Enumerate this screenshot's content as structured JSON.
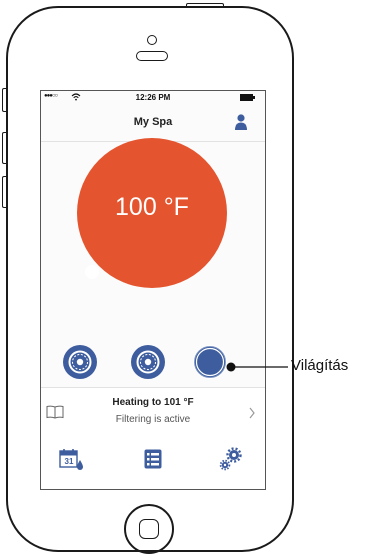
{
  "status_bar": {
    "time": "12:26 PM",
    "signal_dots": "●●●○○"
  },
  "header": {
    "title": "My Spa",
    "profile_icon": "person-icon"
  },
  "temperature": {
    "display": "100 °F",
    "color": "#e4542e"
  },
  "controls": {
    "jet1_icon": "jet-icon",
    "jet2_icon": "jet-icon",
    "light_icon": "light-icon",
    "color": "#3d5d9e"
  },
  "status_panel": {
    "heating_text": "Heating to 101 °F",
    "filter_text": "Filtering is active"
  },
  "tabs": [
    {
      "icon": "calendar-icon",
      "date": "31"
    },
    {
      "icon": "list-icon"
    },
    {
      "icon": "settings-gears-icon"
    }
  ],
  "callout": {
    "label": "Világítás"
  }
}
